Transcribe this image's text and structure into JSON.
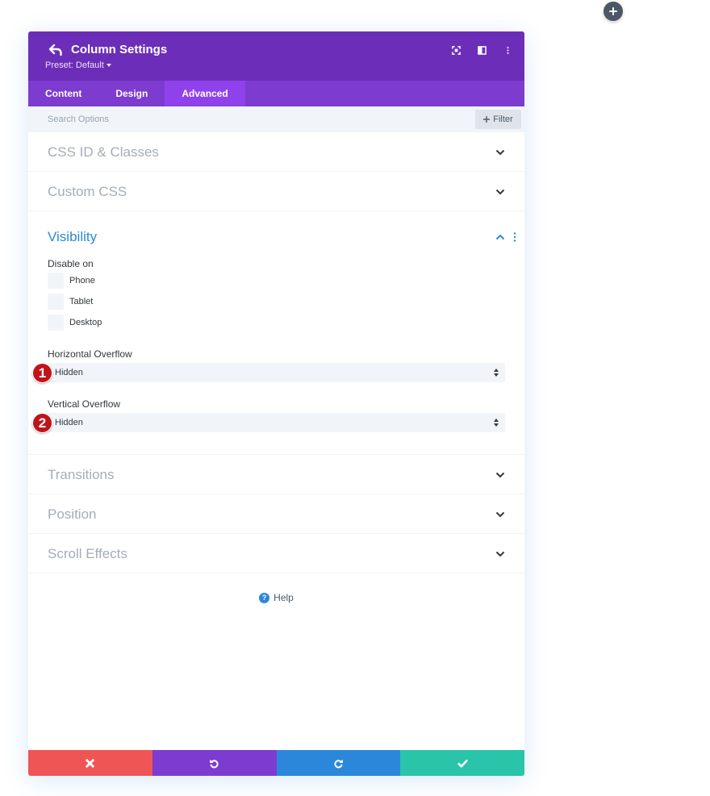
{
  "colors": {
    "header_bg": "#6c2eb9",
    "tabs_bg": "#7d3bcf",
    "tab_active_bg": "#8f42ec",
    "accent_blue": "#2b87da",
    "marker_red": "#c0141b",
    "discard": "#ef5555",
    "undo": "#7e3bd0",
    "redo": "#2b87da",
    "save": "#29c4a9"
  },
  "header": {
    "title": "Column Settings",
    "preset": "Preset: Default",
    "icons": [
      "back-arrow-icon",
      "fullscreen-icon",
      "split-view-icon",
      "more-options-icon"
    ]
  },
  "tabs": [
    {
      "label": "Content",
      "active": false
    },
    {
      "label": "Design",
      "active": false
    },
    {
      "label": "Advanced",
      "active": true
    }
  ],
  "search": {
    "placeholder": "Search Options",
    "filter_label": "Filter"
  },
  "sections": {
    "css_id": "CSS ID & Classes",
    "custom_css": "Custom CSS",
    "visibility": "Visibility",
    "transitions": "Transitions",
    "position": "Position",
    "scroll_effects": "Scroll Effects"
  },
  "visibility": {
    "disable_on_label": "Disable on",
    "options": [
      "Phone",
      "Tablet",
      "Desktop"
    ],
    "horizontal_overflow_label": "Horizontal Overflow",
    "horizontal_overflow_value": "Hidden",
    "vertical_overflow_label": "Vertical Overflow",
    "vertical_overflow_value": "Hidden",
    "markers": [
      "1",
      "2"
    ]
  },
  "help_label": "Help",
  "footer": {
    "buttons": [
      "discard-icon",
      "undo-icon",
      "redo-icon",
      "save-check-icon"
    ]
  }
}
